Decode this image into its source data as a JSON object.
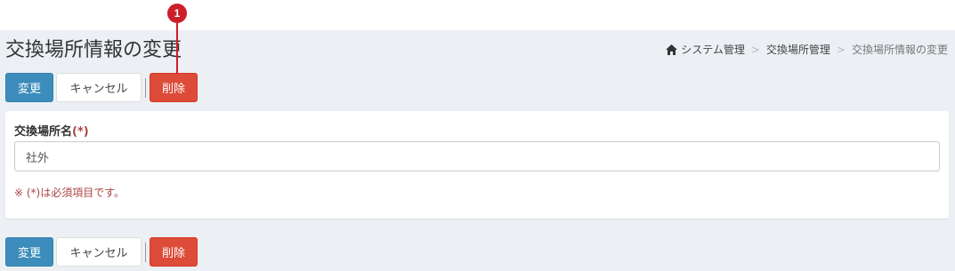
{
  "page": {
    "title": "交換場所情報の変更"
  },
  "breadcrumb": {
    "items": [
      "システム管理",
      "交換場所管理",
      "交換場所情報の変更"
    ],
    "separator": ">"
  },
  "actions": {
    "change_label": "変更",
    "cancel_label": "キャンセル",
    "delete_label": "削除"
  },
  "form": {
    "field_label": "交換場所名",
    "required_mark": "(*)",
    "field_value": "社外",
    "note": "※ (*)は必須項目です。"
  },
  "annotation": {
    "marker_number": "1"
  },
  "colors": {
    "primary": "#3c8dbc",
    "danger": "#dd4b39",
    "content_bg": "#ecf0f5",
    "required": "#a94442",
    "marker": "#cc1f2a"
  },
  "icons": {
    "breadcrumb_home": "home-icon"
  }
}
